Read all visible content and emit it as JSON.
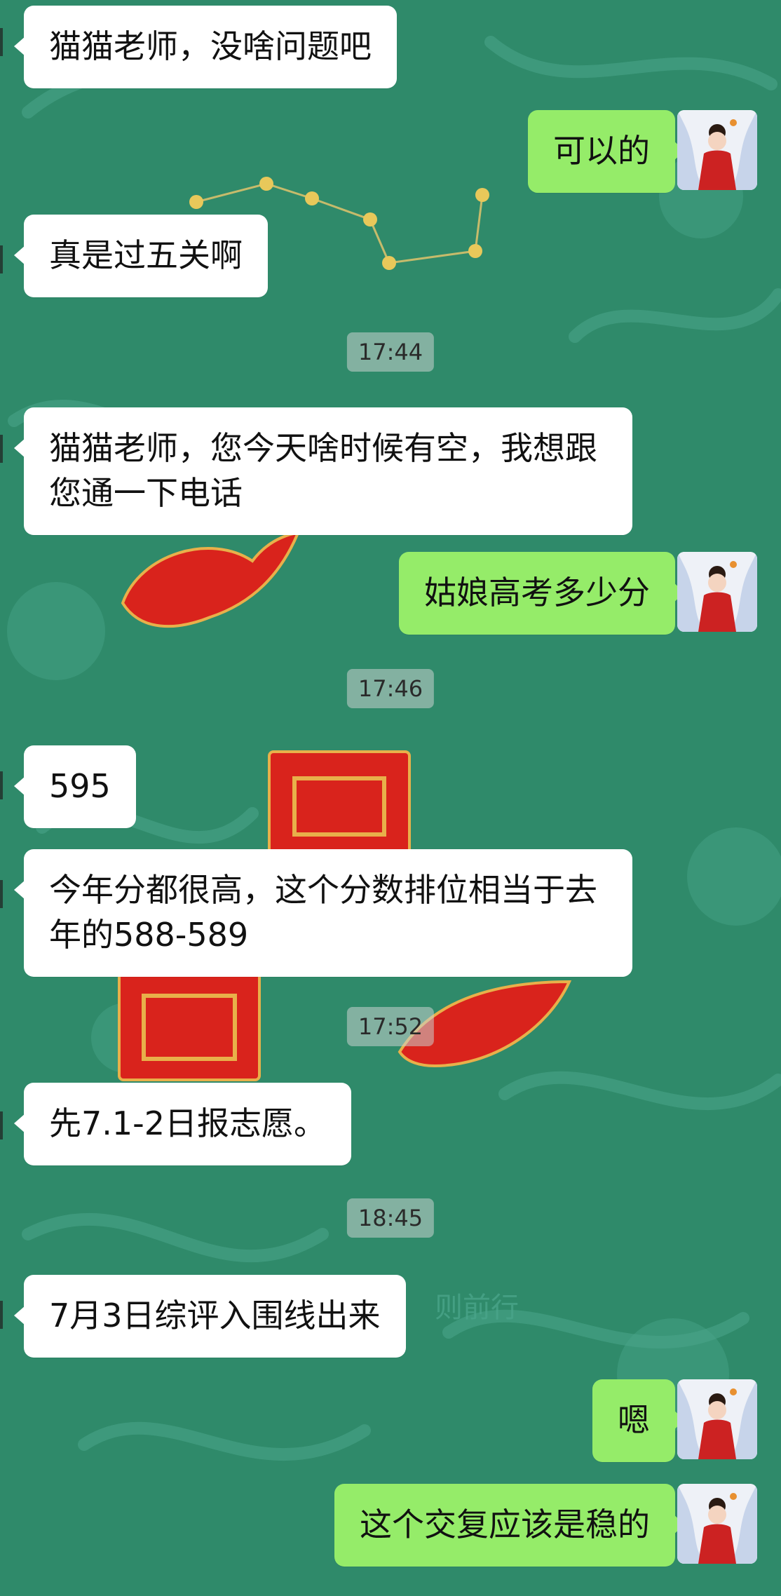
{
  "colors": {
    "background": "#2f8a6a",
    "incoming_bubble": "#ffffff",
    "outgoing_bubble": "#95ec69",
    "seal_red": "#d9231c"
  },
  "chat": {
    "messages": [
      {
        "id": "m1",
        "side": "in",
        "text": "猫猫老师，没啥问题吧"
      },
      {
        "id": "m2",
        "side": "out",
        "text": "可以的"
      },
      {
        "id": "m3",
        "side": "in",
        "text": "真是过五关啊"
      },
      {
        "id": "t1",
        "type": "time",
        "text": "17:44"
      },
      {
        "id": "m4",
        "side": "in",
        "text": "猫猫老师，您今天啥时候有空，我想跟您通一下电话"
      },
      {
        "id": "m5",
        "side": "out",
        "text": "姑娘高考多少分"
      },
      {
        "id": "t2",
        "type": "time",
        "text": "17:46"
      },
      {
        "id": "m6",
        "side": "in",
        "text": "595"
      },
      {
        "id": "m7",
        "side": "in",
        "text": "今年分都很高，这个分数排位相当于去年的588-589"
      },
      {
        "id": "t3",
        "type": "time",
        "text": "17:52"
      },
      {
        "id": "m8",
        "side": "in",
        "text": "先7.1-2日报志愿。"
      },
      {
        "id": "t4",
        "type": "time",
        "text": "18:45"
      },
      {
        "id": "m9",
        "side": "in",
        "text": "7月3日综评入围线出来"
      },
      {
        "id": "m10",
        "side": "out",
        "text": "嗯"
      },
      {
        "id": "m11",
        "side": "out",
        "text": "这个交复应该是稳的"
      }
    ]
  },
  "background_text": "则前行",
  "avatar_icon": "user-avatar-red-hanfu"
}
